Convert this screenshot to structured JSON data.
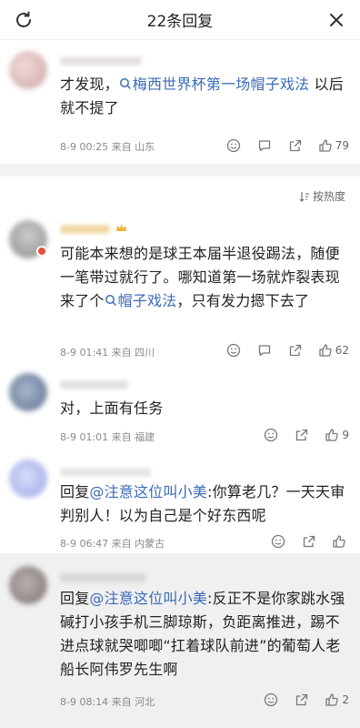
{
  "header": {
    "title": "22条回复",
    "refresh_icon": "refresh-icon",
    "close_icon": "close-icon"
  },
  "sort_label": "按热度",
  "comments": [
    {
      "prefix": "才发现，",
      "link": "梅西世界杯第一场帽子戏法",
      "suffix": " 以后就不提了",
      "meta": "8-9 00:25  来自 山东",
      "likes": "79"
    },
    {
      "prefix": "可能本来想的是球王本届半退役踢法，随便一笔带过就行了。哪知道第一场就炸裂表现来了个",
      "link": "帽子戏法",
      "suffix": "，只有发力摁下去了",
      "meta": "8-9 01:41  来自 四川",
      "likes": "62"
    },
    {
      "text": "对，上面有任务",
      "meta": "8-9 01:01  来自 福建",
      "likes": "9"
    },
    {
      "reply_prefix": "回复",
      "mention": "@注意这位叫小美",
      "text": ":你算老几？一天天审判别人！以为自己是个好东西呢",
      "meta": "8-9 06:47  来自 内蒙古",
      "likes": ""
    },
    {
      "reply_prefix": "回复",
      "mention": "@注意这位叫小美",
      "text": ":反正不是你家跳水强碱打小孩手机三脚琼斯，负距离推进，踢不进点球就哭唧唧“扛着球队前进”的葡萄人老船长阿伟罗先生啊",
      "meta": "8-9 08:14  来自 河北",
      "likes": "2"
    }
  ],
  "colors": {
    "link": "#3b6bb8",
    "meta": "#8a8a8a",
    "divider": "#f2f2f2"
  }
}
